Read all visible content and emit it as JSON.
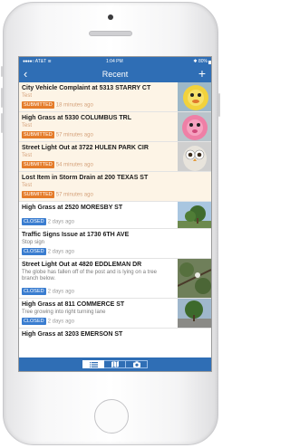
{
  "status_bar": {
    "carrier": "AT&T",
    "time": "1:04 PM",
    "battery": "80%"
  },
  "nav": {
    "title": "Recent",
    "back_icon": "chevron-left-icon",
    "add_icon": "plus-icon"
  },
  "colors": {
    "primary": "#2f6eb5",
    "submitted": "#e57c2a",
    "closed": "#3a7dd0",
    "highlight_row": "#fdf4e6"
  },
  "reports": [
    {
      "title": "City Vehicle Complaint at 5313 STARRY CT",
      "desc": "Test",
      "status": "SUBMITTED",
      "time": "18 minutes ago",
      "photo": "yellow-fluffy-toy"
    },
    {
      "title": "High Grass at 5330 COLUMBUS TRL",
      "desc": "Test",
      "status": "SUBMITTED",
      "time": "57 minutes ago",
      "photo": "pink-fluffy-toy"
    },
    {
      "title": "Street Light Out at 3722 HULEN PARK CIR",
      "desc": "Test",
      "status": "SUBMITTED",
      "time": "54 minutes ago",
      "photo": "owl-toy"
    },
    {
      "title": "Lost Item in Storm Drain at 200 TEXAS ST",
      "desc": "Test",
      "status": "SUBMITTED",
      "time": "57 minutes ago",
      "photo": ""
    },
    {
      "title": "High Grass at 2520 MORESBY ST",
      "desc": "",
      "status": "CLOSED",
      "time": "2 days ago",
      "photo": "tree-and-sky"
    },
    {
      "title": "Traffic Signs Issue at 1730 6TH AVE",
      "desc": "Stop sign",
      "status": "CLOSED",
      "time": "2 days ago",
      "photo": ""
    },
    {
      "title": "Street Light Out at 4820 EDDLEMAN DR",
      "desc": "The globe has fallen off of the post and is lying on a tree branch below.",
      "status": "CLOSED",
      "time": "2 days ago",
      "photo": "tree-branch"
    },
    {
      "title": "High Grass at 811 COMMERCE ST",
      "desc": "Tree growing into right turning lane",
      "status": "CLOSED",
      "time": "2 days ago",
      "photo": "street-tree"
    },
    {
      "title": "High Grass at 3203 EMERSON ST",
      "desc": "",
      "status": "",
      "time": "",
      "photo": ""
    }
  ],
  "tabs": [
    {
      "icon": "list-icon",
      "active": true
    },
    {
      "icon": "map-icon",
      "active": false
    },
    {
      "icon": "camera-icon",
      "active": false
    }
  ]
}
